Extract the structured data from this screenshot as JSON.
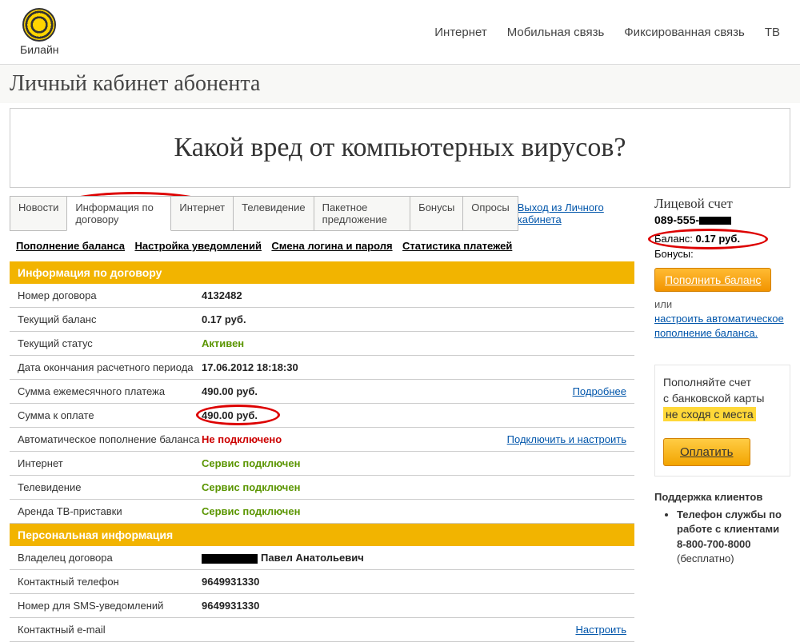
{
  "logo": {
    "name": "Билайн"
  },
  "topNav": {
    "internet": "Интернет",
    "mobile": "Мобильная связь",
    "fixed": "Фиксированная связь",
    "tv": "ТВ"
  },
  "pageTitle": "Личный кабинет абонента",
  "banner": "Какой вред от компьютерных вирусов?",
  "tabs": {
    "news": "Новости",
    "contract": "Информация по договору",
    "internet": "Интернет",
    "tv": "Телевидение",
    "package": "Пакетное предложение",
    "bonus": "Бонусы",
    "polls": "Опросы"
  },
  "logout": "Выход из Личного кабинета",
  "subNav": {
    "topup": "Пополнение баланса",
    "notify": "Настройка уведомлений",
    "login": "Смена логина и пароля",
    "stats": "Статистика платежей"
  },
  "sections": {
    "contractInfo": "Информация по договору",
    "personalInfo": "Персональная информация"
  },
  "contract": {
    "rows": [
      {
        "label": "Номер договора",
        "value": "4132482"
      },
      {
        "label": "Текущий баланс",
        "value": "0.17 руб."
      },
      {
        "label": "Текущий статус",
        "value": "Активен",
        "class": "green"
      },
      {
        "label": "Дата окончания расчетного периода",
        "value": "17.06.2012 18:18:30"
      },
      {
        "label": "Сумма ежемесячного платежа",
        "value": "490.00 руб.",
        "action": "Подробнее"
      },
      {
        "label": "Сумма к оплате",
        "value": "490.00 руб.",
        "highlight": true
      },
      {
        "label": "Автоматическое пополнение баланса",
        "value": "Не подключено",
        "class": "red",
        "action": "Подключить и настроить"
      },
      {
        "label": "Интернет",
        "value": "Сервис подключен",
        "class": "green"
      },
      {
        "label": "Телевидение",
        "value": "Сервис подключен",
        "class": "green"
      },
      {
        "label": "Аренда ТВ-приставки",
        "value": "Сервис подключен",
        "class": "green"
      }
    ]
  },
  "personal": {
    "rows": [
      {
        "label": "Владелец договора",
        "value": "Павел Анатольевич",
        "redacted": true
      },
      {
        "label": "Контактный телефон",
        "value": "9649931330"
      },
      {
        "label": "Номер для SMS-уведомлений",
        "value": "9649931330"
      },
      {
        "label": "Контактный e-mail",
        "value": "",
        "action": "Настроить"
      }
    ]
  },
  "sidebar": {
    "accountTitle": "Лицевой счет",
    "accountNumber": "089-555-",
    "balanceLabel": "Баланс:",
    "balanceValue": "0.17 руб.",
    "bonusLabel": "Бонусы:",
    "topupBtn": "Пополнить баланс",
    "or": "или",
    "autoLink": "настроить автоматическое пополнение баланса.",
    "promoLine1": "Пополняйте счет",
    "promoLine2": "с банковской карты",
    "promoLine3": "не сходя с места",
    "payBtn": "Оплатить",
    "supportTitle": "Поддержка клиентов",
    "supportItem": "Телефон службы по работе с клиентами",
    "supportPhone": "8-800-700-8000",
    "supportFree": "(бесплатно)"
  }
}
